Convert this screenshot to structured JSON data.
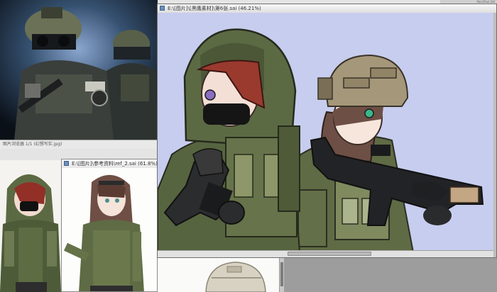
{
  "windows": {
    "main": {
      "title": "E:\\[图片]\\[黑鹰素材]\\第6张.sai (46.21%)",
      "colors": {
        "canvas_bg": "#c7cdee",
        "jacket": "#5f6b45",
        "helmet": "#a5977a",
        "hair_red": "#9a3a2e",
        "hair_brown": "#6e4f45"
      }
    },
    "photo": {
      "status": "图片浏览器 1/1 (幻想写实.jpg)"
    },
    "bottom": {
      "title": "E:\\[图片]\\参考资料\\ref_2.sai (61.8%)"
    },
    "top_strip": "PaintTool SAI"
  },
  "icons": {
    "window": "window-icon"
  }
}
